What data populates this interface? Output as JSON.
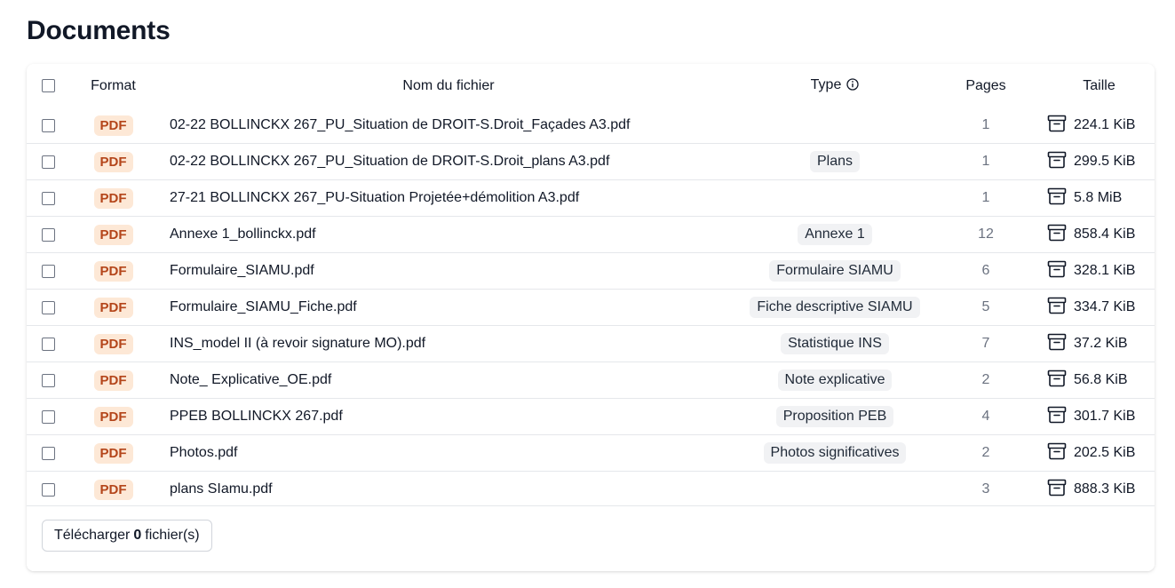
{
  "page": {
    "title": "Documents"
  },
  "table": {
    "headers": {
      "format": "Format",
      "name": "Nom du fichier",
      "type": "Type",
      "pages": "Pages",
      "size": "Taille"
    },
    "rows": [
      {
        "format": "PDF",
        "name": "02-22 BOLLINCKX 267_PU_Situation de DROIT-S.Droit_Façades A3.pdf",
        "type": "",
        "pages": "1",
        "size": "224.1 KiB"
      },
      {
        "format": "PDF",
        "name": "02-22 BOLLINCKX 267_PU_Situation de DROIT-S.Droit_plans A3.pdf",
        "type": "Plans",
        "pages": "1",
        "size": "299.5 KiB"
      },
      {
        "format": "PDF",
        "name": "27-21 BOLLINCKX 267_PU-Situation Projetée+démolition A3.pdf",
        "type": "",
        "pages": "1",
        "size": "5.8 MiB"
      },
      {
        "format": "PDF",
        "name": "Annexe 1_bollinckx.pdf",
        "type": "Annexe 1",
        "pages": "12",
        "size": "858.4 KiB"
      },
      {
        "format": "PDF",
        "name": "Formulaire_SIAMU.pdf",
        "type": "Formulaire SIAMU",
        "pages": "6",
        "size": "328.1 KiB"
      },
      {
        "format": "PDF",
        "name": "Formulaire_SIAMU_Fiche.pdf",
        "type": "Fiche descriptive SIAMU",
        "pages": "5",
        "size": "334.7 KiB"
      },
      {
        "format": "PDF",
        "name": "INS_model II (à revoir signature MO).pdf",
        "type": "Statistique INS",
        "pages": "7",
        "size": "37.2 KiB"
      },
      {
        "format": "PDF",
        "name": "Note_ Explicative_OE.pdf",
        "type": "Note explicative",
        "pages": "2",
        "size": "56.8 KiB"
      },
      {
        "format": "PDF",
        "name": "PPEB BOLLINCKX 267.pdf",
        "type": "Proposition PEB",
        "pages": "4",
        "size": "301.7 KiB"
      },
      {
        "format": "PDF",
        "name": "Photos.pdf",
        "type": "Photos significatives",
        "pages": "2",
        "size": "202.5 KiB"
      },
      {
        "format": "PDF",
        "name": "plans SIamu.pdf",
        "type": "",
        "pages": "3",
        "size": "888.3 KiB"
      }
    ]
  },
  "footer": {
    "download_prefix": "Télécharger",
    "download_count": "0",
    "download_suffix": "fichier(s)"
  },
  "icons": {
    "type_info": "info-circle-icon",
    "size": "archive-box-icon"
  },
  "colors": {
    "pdf_badge_bg": "#fde8d6",
    "pdf_badge_text": "#b4451a",
    "type_chip_bg": "#f1f2f4"
  }
}
